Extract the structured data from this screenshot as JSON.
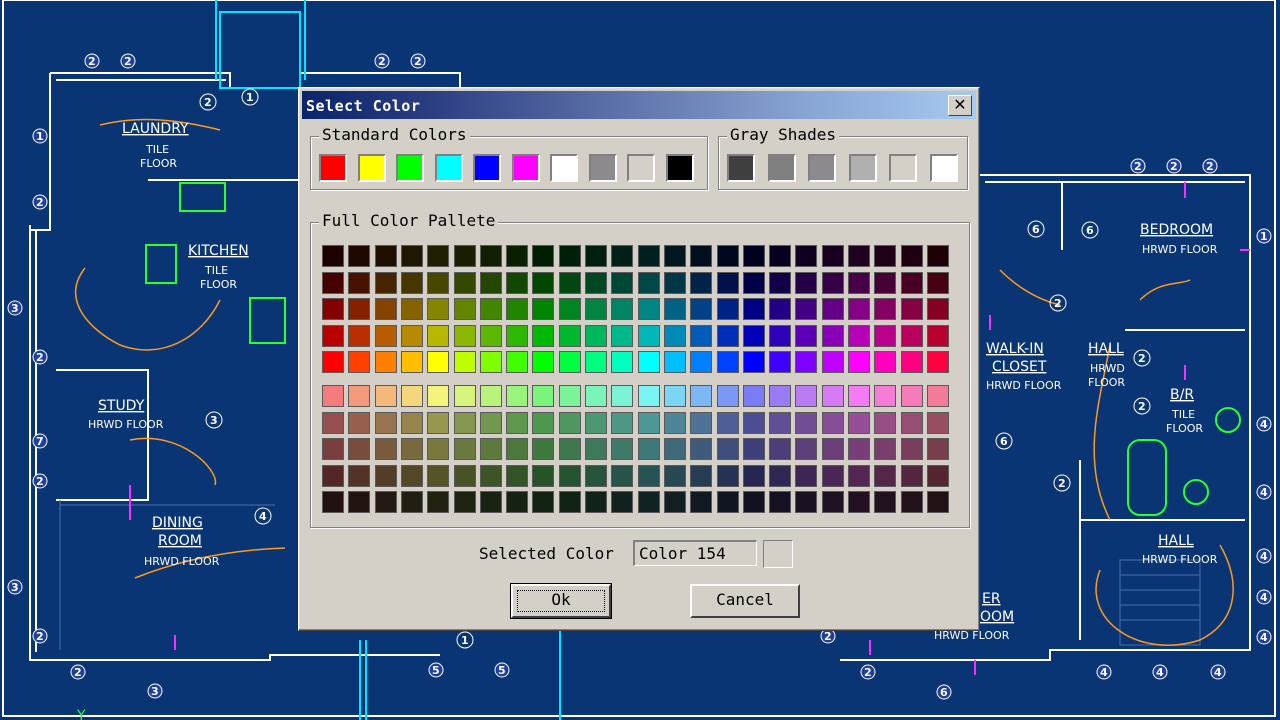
{
  "cad": {
    "background": "#0a3574",
    "rooms": [
      {
        "name": "LAUNDRY",
        "floor": [
          "TILE",
          "FLOOR"
        ]
      },
      {
        "name": "KITCHEN",
        "floor": [
          "TILE",
          "FLOOR"
        ]
      },
      {
        "name": "STUDY",
        "floor": [
          "HRWD FLOOR"
        ]
      },
      {
        "name": "DINING",
        "name2": "ROOM",
        "floor": [
          "HRWD FLOOR"
        ]
      },
      {
        "name": "BEDROOM",
        "floor": [
          "HRWD FLOOR"
        ]
      },
      {
        "name": "WALK-IN",
        "name2": "CLOSET",
        "floor": [
          "HRWD FLOOR"
        ]
      },
      {
        "name": "HALL",
        "floor": [
          "HRWD",
          "FLOOR"
        ]
      },
      {
        "name": "B/R",
        "floor": [
          "TILE",
          "FLOOR"
        ]
      },
      {
        "name": "HALL",
        "floor": [
          "HRWD FLOOR"
        ]
      },
      {
        "name": "ER",
        "name2": "OOM",
        "floor": [
          "HRWD FLOOR"
        ]
      }
    ]
  },
  "dialog": {
    "title": "Select Color",
    "close_label": "✕",
    "standard_group_label": "Standard Colors",
    "standard_colors": [
      "#ff0000",
      "#ffff00",
      "#00ff00",
      "#00ffff",
      "#0000ff",
      "#ff00ff",
      "#ffffff",
      "#8c8a8c",
      "#d4d0c8",
      "#000000"
    ],
    "gray_group_label": "Gray Shades",
    "gray_shades": [
      "#404040",
      "#808080",
      "#8c8a8c",
      "#b0b0b0",
      "#d4d0c8",
      "#ffffff"
    ],
    "palette_group_label": "Full Color Pallete",
    "selected_label": "Selected Color",
    "selected_value": "Color 154",
    "ok_label": "Ok",
    "cancel_label": "Cancel"
  }
}
